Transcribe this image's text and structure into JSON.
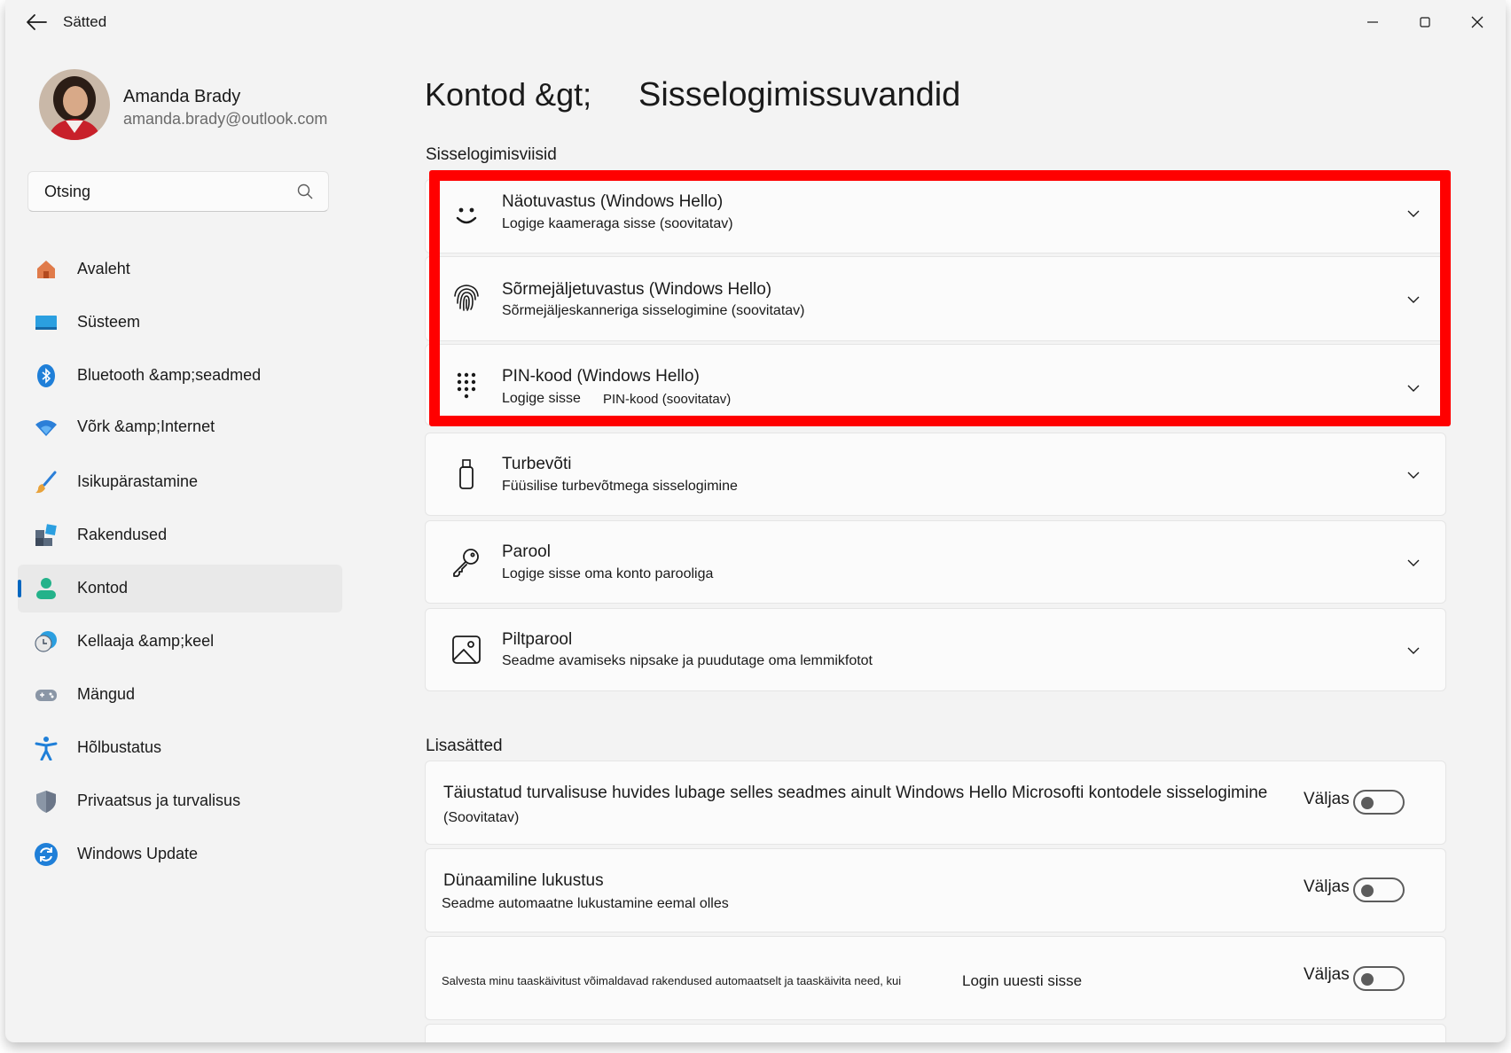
{
  "window": {
    "title": "Sätted"
  },
  "profile": {
    "name": "Amanda Brady",
    "email": "amanda.brady@outlook.com"
  },
  "search": {
    "placeholder": "Otsing"
  },
  "nav": {
    "items": [
      {
        "label": "Avaleht",
        "icon": "home-icon"
      },
      {
        "label": "Süsteem",
        "icon": "system-icon"
      },
      {
        "label": "Bluetooth &amp;seadmed",
        "icon": "bluetooth-icon"
      },
      {
        "label": "Võrk &amp;Internet",
        "icon": "wifi-icon"
      },
      {
        "label": "Isikupärastamine",
        "icon": "brush-icon"
      },
      {
        "label": "Rakendused",
        "icon": "apps-icon"
      },
      {
        "label": "Kontod",
        "icon": "account-icon",
        "active": true
      },
      {
        "label": "Kellaaja &amp;keel",
        "icon": "clock-globe-icon"
      },
      {
        "label": "Mängud",
        "icon": "gamepad-icon"
      },
      {
        "label": "Hõlbustatus",
        "icon": "accessibility-icon"
      },
      {
        "label": "Privaatsus ja turvalisus",
        "icon": "shield-icon"
      },
      {
        "label": "Windows Update",
        "icon": "update-icon"
      }
    ]
  },
  "page": {
    "breadcrumb": "Kontod &gt;",
    "title": "Sisselogimissuvandid"
  },
  "signin_section": {
    "title": "Sisselogimisviisid",
    "options": [
      {
        "title": "Näotuvastus (Windows Hello)",
        "subtitle": "Logige kaameraga sisse (soovitatav)",
        "icon": "face-icon"
      },
      {
        "title": "Sõrmejäljetuvastus (Windows Hello)",
        "subtitle": "Sõrmejäljeskanneriga sisselogimine (soovitatav)",
        "icon": "fingerprint-icon"
      },
      {
        "title": "PIN-kood (Windows Hello)",
        "subtitle_a": "Logige sisse",
        "subtitle_b": "PIN-kood (soovitatav)",
        "icon": "pin-keypad-icon"
      },
      {
        "title": "Turbevõti",
        "subtitle": "Füüsilise turbevõtmega sisselogimine",
        "icon": "usb-key-icon"
      },
      {
        "title": "Parool",
        "subtitle": "Logige sisse oma konto parooliga",
        "icon": "key-icon"
      },
      {
        "title": "Piltparool",
        "subtitle": "Seadme avamiseks nipsake ja puudutage oma lemmikfotot",
        "icon": "picture-icon"
      }
    ]
  },
  "additional_section": {
    "title": "Lisasätted",
    "settings": [
      {
        "title": "Täiustatud turvalisuse huvides lubage selles seadmes ainult Windows Hello Microsofti kontodele sisselogimine",
        "subtitle": "(Soovitatav)",
        "toggle_label": "Väljas",
        "on": false
      },
      {
        "title": "Dünaamiline lukustus",
        "subtitle": "Seadme automaatne lukustamine eemal olles",
        "toggle_label": "Väljas",
        "on": false
      },
      {
        "text_a": "Salvesta minu taaskäivitust võimaldavad rakendused automaatselt ja taaskäivita need, kui",
        "text_b": "Login uuesti sisse",
        "toggle_label": "Väljas",
        "on": false
      }
    ]
  }
}
